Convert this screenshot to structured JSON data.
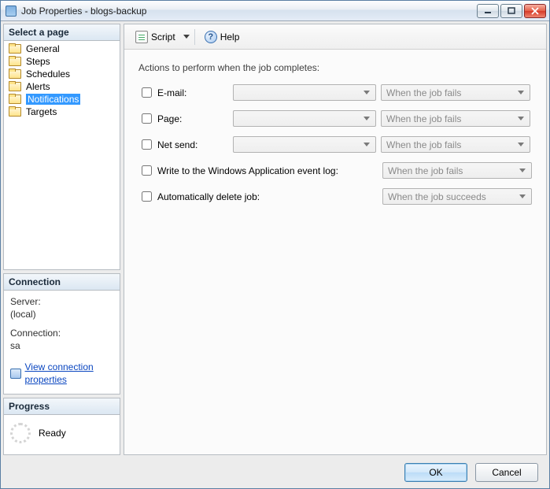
{
  "window": {
    "title": "Job Properties - blogs-backup"
  },
  "left": {
    "select_header": "Select a page",
    "nav": [
      {
        "label": "General"
      },
      {
        "label": "Steps"
      },
      {
        "label": "Schedules"
      },
      {
        "label": "Alerts"
      },
      {
        "label": "Notifications",
        "selected": true
      },
      {
        "label": "Targets"
      }
    ],
    "connection": {
      "header": "Connection",
      "server_label": "Server:",
      "server_value": "(local)",
      "conn_label": "Connection:",
      "conn_value": "sa",
      "link": "View connection properties"
    },
    "progress": {
      "header": "Progress",
      "status": "Ready"
    }
  },
  "toolbar": {
    "script": "Script",
    "help": "Help"
  },
  "main": {
    "section": "Actions to perform when the job completes:",
    "rows": {
      "email": {
        "label": "E-mail:",
        "condition": "When the job fails"
      },
      "page": {
        "label": "Page:",
        "condition": "When the job fails"
      },
      "netsend": {
        "label": "Net send:",
        "condition": "When the job fails"
      },
      "eventlog": {
        "label": "Write to the Windows Application event log:",
        "condition": "When the job fails"
      },
      "autodel": {
        "label": "Automatically delete job:",
        "condition": "When the job succeeds"
      }
    }
  },
  "footer": {
    "ok": "OK",
    "cancel": "Cancel"
  }
}
